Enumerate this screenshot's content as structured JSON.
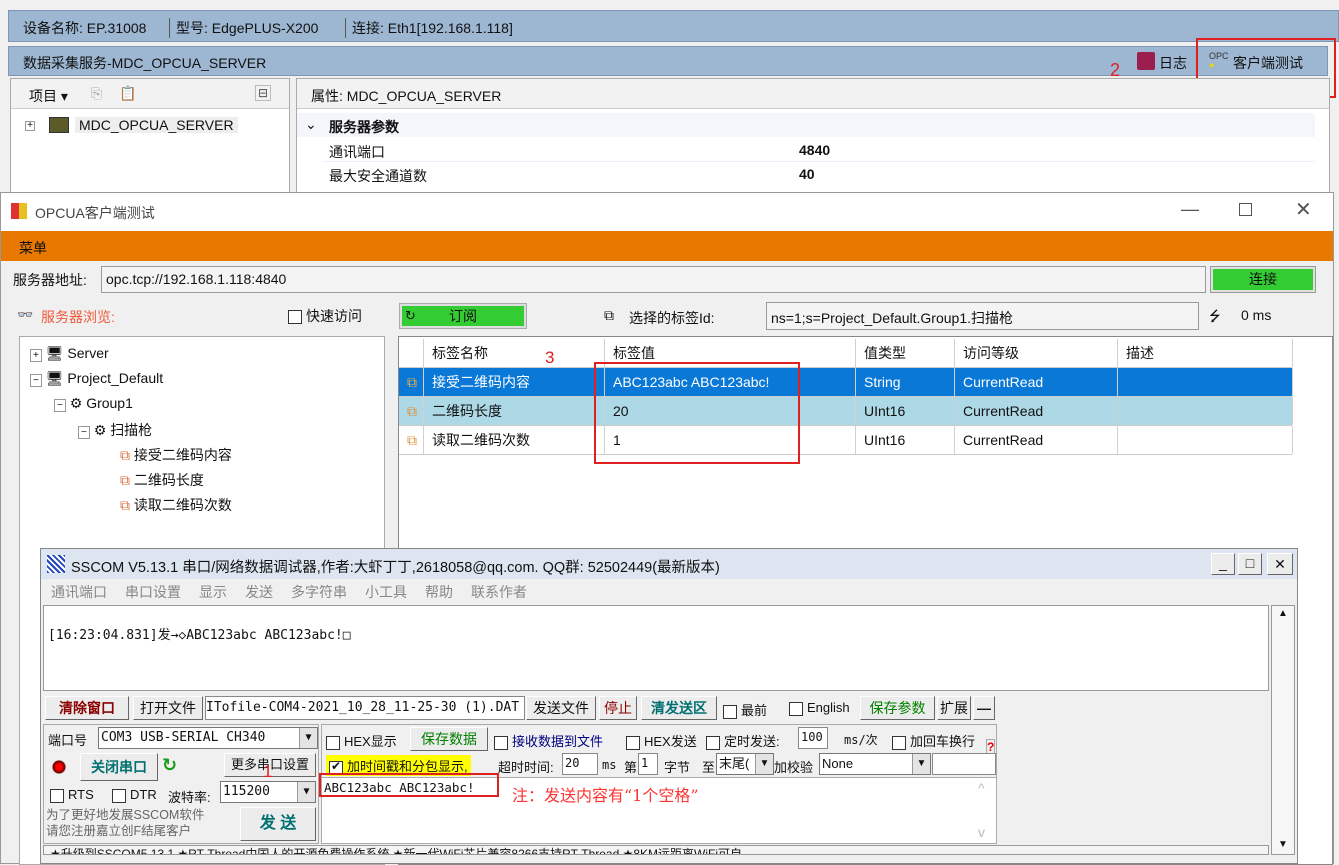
{
  "device_bar": {
    "name": "设备名称: EP.31008",
    "model": "型号: EdgePLUS-X200",
    "connection": "连接: Eth1[192.168.1.118]"
  },
  "service_bar": {
    "title": "数据采集服务-MDC_OPCUA_SERVER",
    "log_button": "日志",
    "client_test_button": "客户端测试",
    "annotation": "2"
  },
  "project_panel": {
    "menu": "项目",
    "tree_item": "MDC_OPCUA_SERVER"
  },
  "property_panel": {
    "title": "属性: MDC_OPCUA_SERVER",
    "group": "服务器参数",
    "rows": [
      {
        "name": "通讯端口",
        "value": "4840"
      },
      {
        "name": "最大安全通道数",
        "value": "40"
      }
    ]
  },
  "opcua_window": {
    "title": "OPCUA客户端测试",
    "menu": "菜单",
    "server_address_label": "服务器地址:",
    "server_address": "opc.tcp://192.168.1.118:4840",
    "connect_button": "连接",
    "browse_label": "服务器浏览:",
    "quick_access": "快速访问",
    "subscribe_button": "订阅",
    "selected_tag_label": "选择的标签Id:",
    "selected_tag_id": "ns=1;s=Project_Default.Group1.扫描枪",
    "latency": "0 ms",
    "tree": [
      "Server",
      "Project_Default",
      "Group1",
      "扫描枪",
      "接受二维码内容",
      "二维码长度",
      "读取二维码次数"
    ],
    "annotation": "3",
    "table": {
      "columns": [
        "标签名称",
        "标签值",
        "值类型",
        "访问等级",
        "描述"
      ],
      "rows": [
        {
          "name": "接受二维码内容",
          "value": "ABC123abc ABC123abc!",
          "type": "String",
          "access": "CurrentRead",
          "desc": ""
        },
        {
          "name": "二维码长度",
          "value": "20",
          "type": "UInt16",
          "access": "CurrentRead",
          "desc": ""
        },
        {
          "name": "读取二维码次数",
          "value": "1",
          "type": "UInt16",
          "access": "CurrentRead",
          "desc": ""
        }
      ]
    }
  },
  "sscom": {
    "title": "SSCOM V5.13.1 串口/网络数据调试器,作者:大虾丁丁,2618058@qq.com. QQ群: 52502449(最新版本)",
    "menu": [
      "通讯端口",
      "串口设置",
      "显示",
      "发送",
      "多字符串",
      "小工具",
      "帮助",
      "联系作者"
    ],
    "receive_log": "[16:23:04.831]发→◇ABC123abc ABC123abc!□",
    "clear_window": "清除窗口",
    "open_file": "打开文件",
    "file_path": "ITofile-COM4-2021_10_28_11-25-30 (1).DAT",
    "send_file": "发送文件",
    "stop": "停止",
    "clear_send": "清发送区",
    "topmost": "最前",
    "english": "English",
    "save_params": "保存参数",
    "expand": "扩展",
    "collapse": "—",
    "port_label": "端口号",
    "port_value": "COM3 USB-SERIAL CH340",
    "close_port": "关闭串口",
    "more_settings": "更多串口设置",
    "rts": "RTS",
    "dtr": "DTR",
    "baud_label": "波特率:",
    "baud_value": "115200",
    "annotation": "1",
    "promo": "为了更好地发展SSCOM软件\n请您注册嘉立创F结尾客户",
    "send_button": "发  送",
    "hex_display": "HEX显示",
    "save_data": "保存数据",
    "receive_to_file": "接收数据到文件",
    "hex_send": "HEX发送",
    "timed_send": "定时发送:",
    "interval": "100",
    "interval_unit": "ms/次",
    "add_crlf": "加回车换行",
    "timestamp": "加时间戳和分包显示,",
    "timeout_label": "超时时间:",
    "timeout": "20",
    "timeout_unit": "ms",
    "byte_from_label": "第",
    "byte_from": "1",
    "byte_label": "字节",
    "to_label": "至",
    "to_value": "末尾(",
    "checksum_label": "加校验",
    "checksum": "None",
    "send_text": "ABC123abc ABC123abc!",
    "note": "注：发送内容有“1个空格”",
    "help": "?",
    "status_line": "★升级到SSCOM5.13.1 ★RT-Thread中国人的开源免费操作系统 ★新一代WiFi芯片兼容8266支持RT-Thread ★8KM远距离WiFi可自"
  },
  "colors": {
    "orange_menu": "#e97800",
    "green_button": "#33cc33",
    "selected_row": "#0a78d7",
    "alt_row": "#add8e6",
    "annotation_red": "#e02020",
    "toolbar_blue": "#9db6d2"
  }
}
